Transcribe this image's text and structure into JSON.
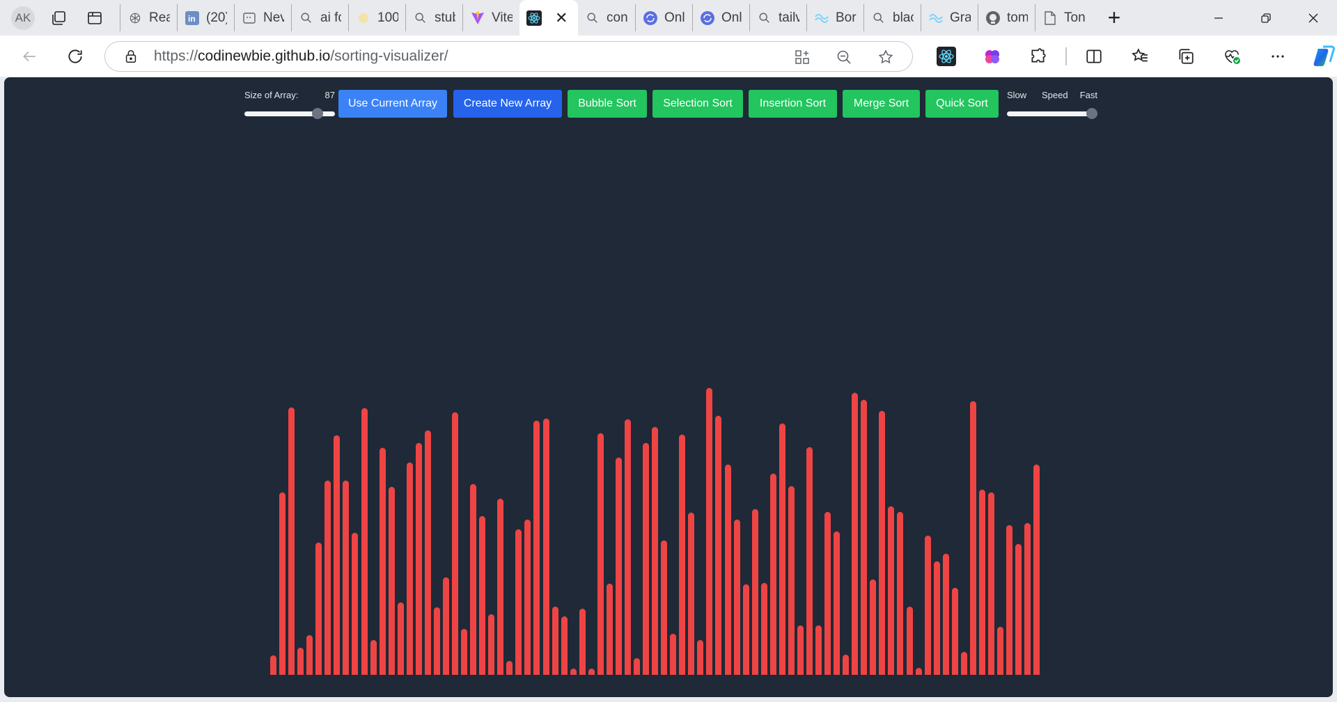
{
  "browser": {
    "profile_initials": "AK",
    "tabs": [
      {
        "label": "Rea",
        "icon": "openai-icon"
      },
      {
        "label": "(20)",
        "icon": "linkedin-icon"
      },
      {
        "label": "Nev",
        "icon": "newtab-icon"
      },
      {
        "label": "ai fo",
        "icon": "search-icon"
      },
      {
        "label": "100'",
        "icon": "sun-icon"
      },
      {
        "label": "stub",
        "icon": "search-icon"
      },
      {
        "label": "Vite",
        "icon": "vite-icon"
      },
      {
        "label": "",
        "icon": "react-icon",
        "active": true
      },
      {
        "label": "con",
        "icon": "search-icon"
      },
      {
        "label": "Onli",
        "icon": "sync-icon"
      },
      {
        "label": "Onli",
        "icon": "sync-icon"
      },
      {
        "label": "tailv",
        "icon": "search-icon"
      },
      {
        "label": "Borc",
        "icon": "tailwind-icon"
      },
      {
        "label": "blac",
        "icon": "search-icon"
      },
      {
        "label": "Gra",
        "icon": "tailwind-icon"
      },
      {
        "label": "tom",
        "icon": "github-icon"
      },
      {
        "label": "Ton",
        "icon": "document-icon"
      }
    ],
    "url_scheme": "https://",
    "url_host": "codinewbie.github.io",
    "url_path": "/sorting-visualizer/"
  },
  "app": {
    "size_label": "Size of Array:",
    "size_value": "87",
    "size_fraction": 0.85,
    "buttons": {
      "use_current": "Use Current Array",
      "create_new": "Create New Array",
      "bubble": "Bubble Sort",
      "selection": "Selection Sort",
      "insertion": "Insertion Sort",
      "merge": "Merge Sort",
      "quick": "Quick Sort"
    },
    "speed_slow": "Slow",
    "speed_label": "Speed",
    "speed_fast": "Fast",
    "speed_fraction": 1.0,
    "bar_color": "#ef4444",
    "background_color": "#1f2937",
    "array_values": [
      22,
      206,
      302,
      31,
      45,
      149,
      219,
      270,
      219,
      160,
      301,
      39,
      256,
      212,
      82,
      240,
      262,
      276,
      76,
      110,
      296,
      52,
      215,
      179,
      68,
      199,
      16,
      164,
      175,
      287,
      289,
      77,
      66,
      7,
      75,
      7,
      273,
      103,
      245,
      288,
      19,
      262,
      280,
      152,
      46,
      271,
      183,
      39,
      324,
      292,
      237,
      175,
      102,
      187,
      104,
      227,
      284,
      213,
      56,
      257,
      56,
      184,
      162,
      23,
      318,
      310,
      108,
      298,
      190,
      184,
      77,
      8,
      157,
      128,
      137,
      98,
      26,
      309,
      209,
      206,
      54,
      169,
      148,
      171,
      237
    ],
    "max_value": 330
  }
}
